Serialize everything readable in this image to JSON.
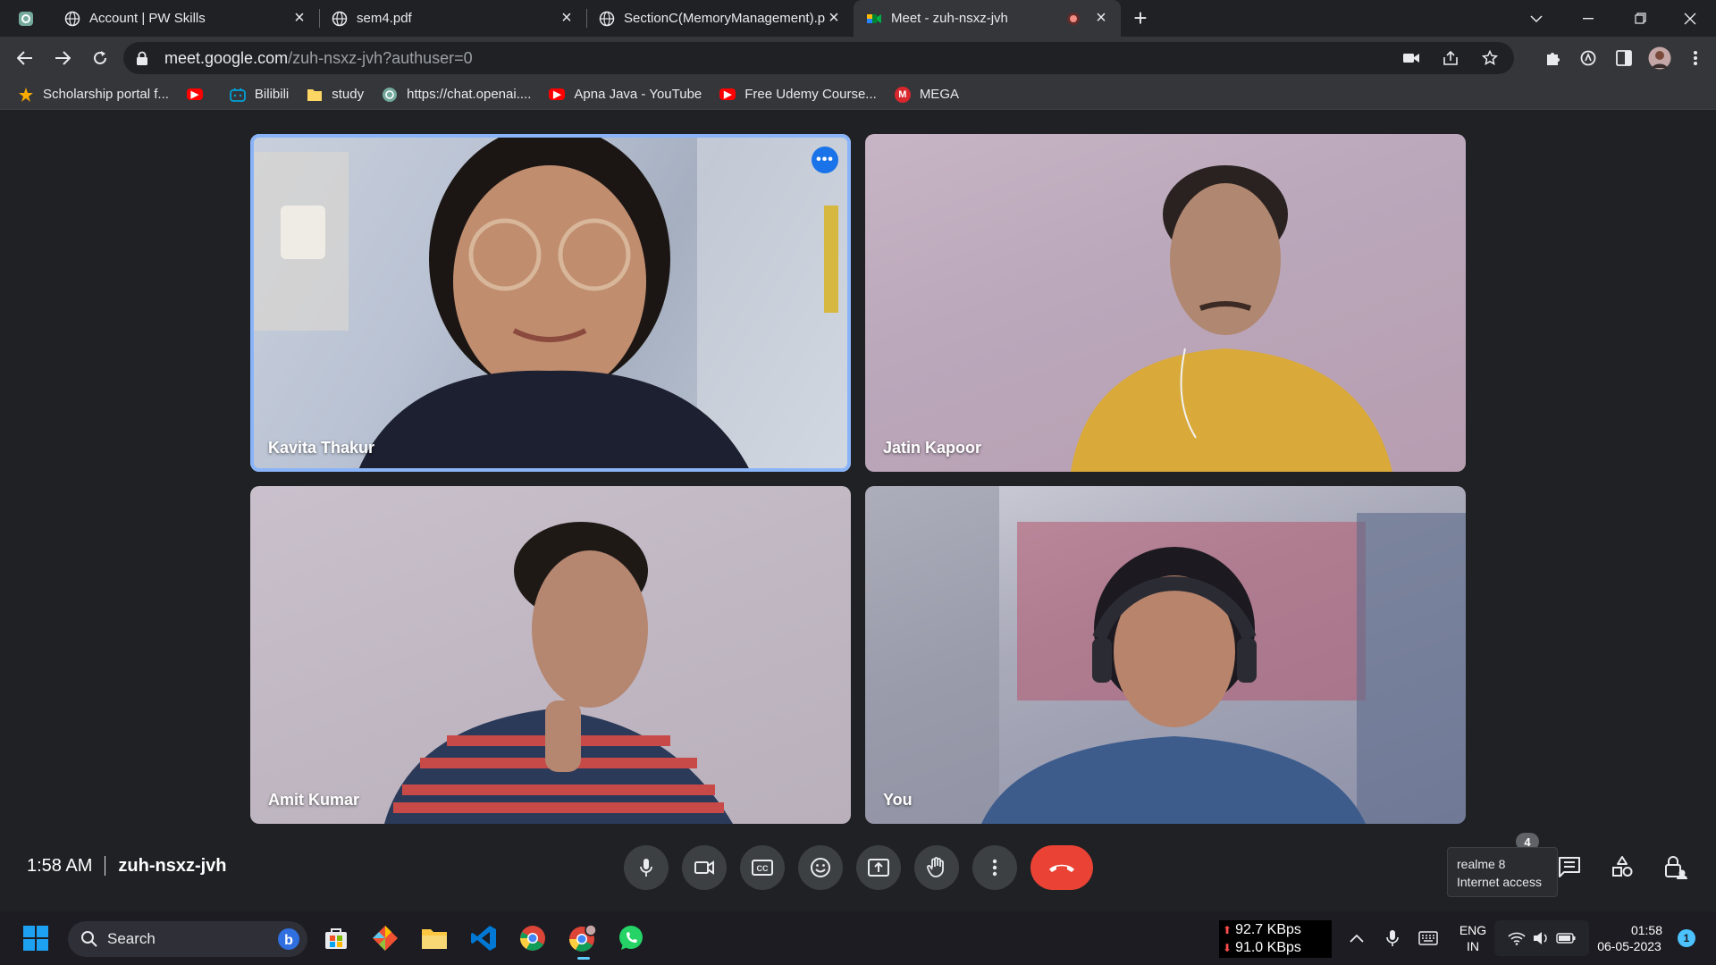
{
  "browser": {
    "tabs": [
      {
        "title": "Account | PW Skills",
        "favicon": "globe-icon",
        "active": false
      },
      {
        "title": "sem4.pdf",
        "favicon": "globe-icon",
        "active": false
      },
      {
        "title": "SectionC(MemoryManagement).p",
        "favicon": "globe-icon",
        "active": false
      },
      {
        "title": "Meet - zuh-nsxz-jvh",
        "favicon": "meet-icon",
        "active": true,
        "recording": true
      }
    ],
    "url_host": "meet.google.com",
    "url_path": "/zuh-nsxz-jvh?authuser=0",
    "bookmarks": [
      {
        "label": "Scholarship portal f...",
        "icon": "scholarship-icon",
        "color": "#f9ab00"
      },
      {
        "label": "",
        "icon": "youtube-icon",
        "color": "#ff0000"
      },
      {
        "label": "Bilibili",
        "icon": "bilibili-icon",
        "color": "#00a1d6"
      },
      {
        "label": "study",
        "icon": "folder-icon",
        "color": "#fdd663"
      },
      {
        "label": "https://chat.openai....",
        "icon": "openai-icon",
        "color": "#74aa9c"
      },
      {
        "label": "Apna Java - YouTube",
        "icon": "youtube-icon",
        "color": "#ff0000"
      },
      {
        "label": "Free Udemy Course...",
        "icon": "youtube-icon",
        "color": "#ff0000"
      },
      {
        "label": "MEGA",
        "icon": "mega-icon",
        "color": "#d9272e"
      }
    ]
  },
  "meet": {
    "participants": [
      {
        "name": "Kavita Thakur",
        "active_speaker": true
      },
      {
        "name": "Jatin Kapoor",
        "active_speaker": false
      },
      {
        "name": "Amit Kumar",
        "active_speaker": false
      },
      {
        "name": "You",
        "active_speaker": false
      }
    ],
    "time": "1:58 AM",
    "meeting_code": "zuh-nsxz-jvh",
    "participant_count": "4",
    "tooltip_line1": "realme 8",
    "tooltip_line2": "Internet access"
  },
  "taskbar": {
    "search_placeholder": "Search",
    "upload_speed": "92.7 KBps",
    "download_speed": "91.0 KBps",
    "language": "ENG",
    "region": "IN",
    "clock_time": "01:58",
    "clock_date": "06-05-2023",
    "notification_count": "1"
  },
  "colors": {
    "accent_blue": "#8ab4f8",
    "hangup_red": "#ea4335",
    "meet_background": "#202124"
  }
}
